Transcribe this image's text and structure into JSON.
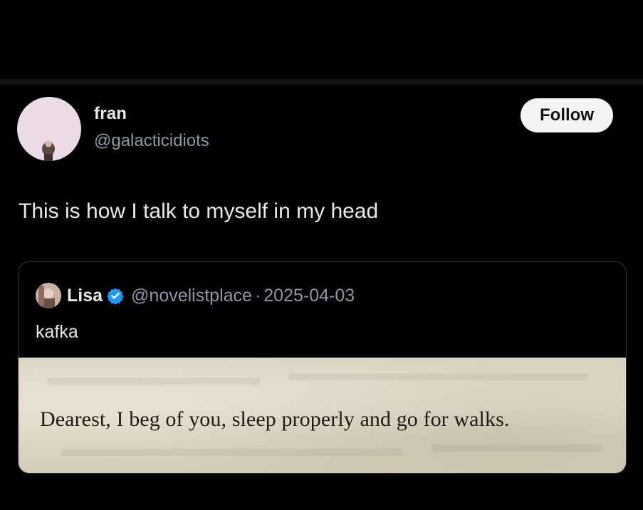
{
  "author": {
    "display_name": "fran",
    "handle": "@galacticidiots",
    "avatar_icon": "profile-photo-icon"
  },
  "follow_label": "Follow",
  "tweet_text": "This is how I talk to myself in my head",
  "quote": {
    "name": "Lisa",
    "verified_icon": "verified-badge-icon",
    "handle": "@novelistplace",
    "separator": "·",
    "date": "2025-04-03",
    "text": "kafka",
    "image_text": "Dearest, I beg of you, sleep properly and go for walks."
  },
  "colors": {
    "background": "#000000",
    "primary_text": "#e7e9ea",
    "secondary_text": "#8b98a5",
    "follow_button_bg": "#f4f4f4",
    "verified_blue": "#1d9bf0",
    "paper": "#ddd5c3"
  }
}
